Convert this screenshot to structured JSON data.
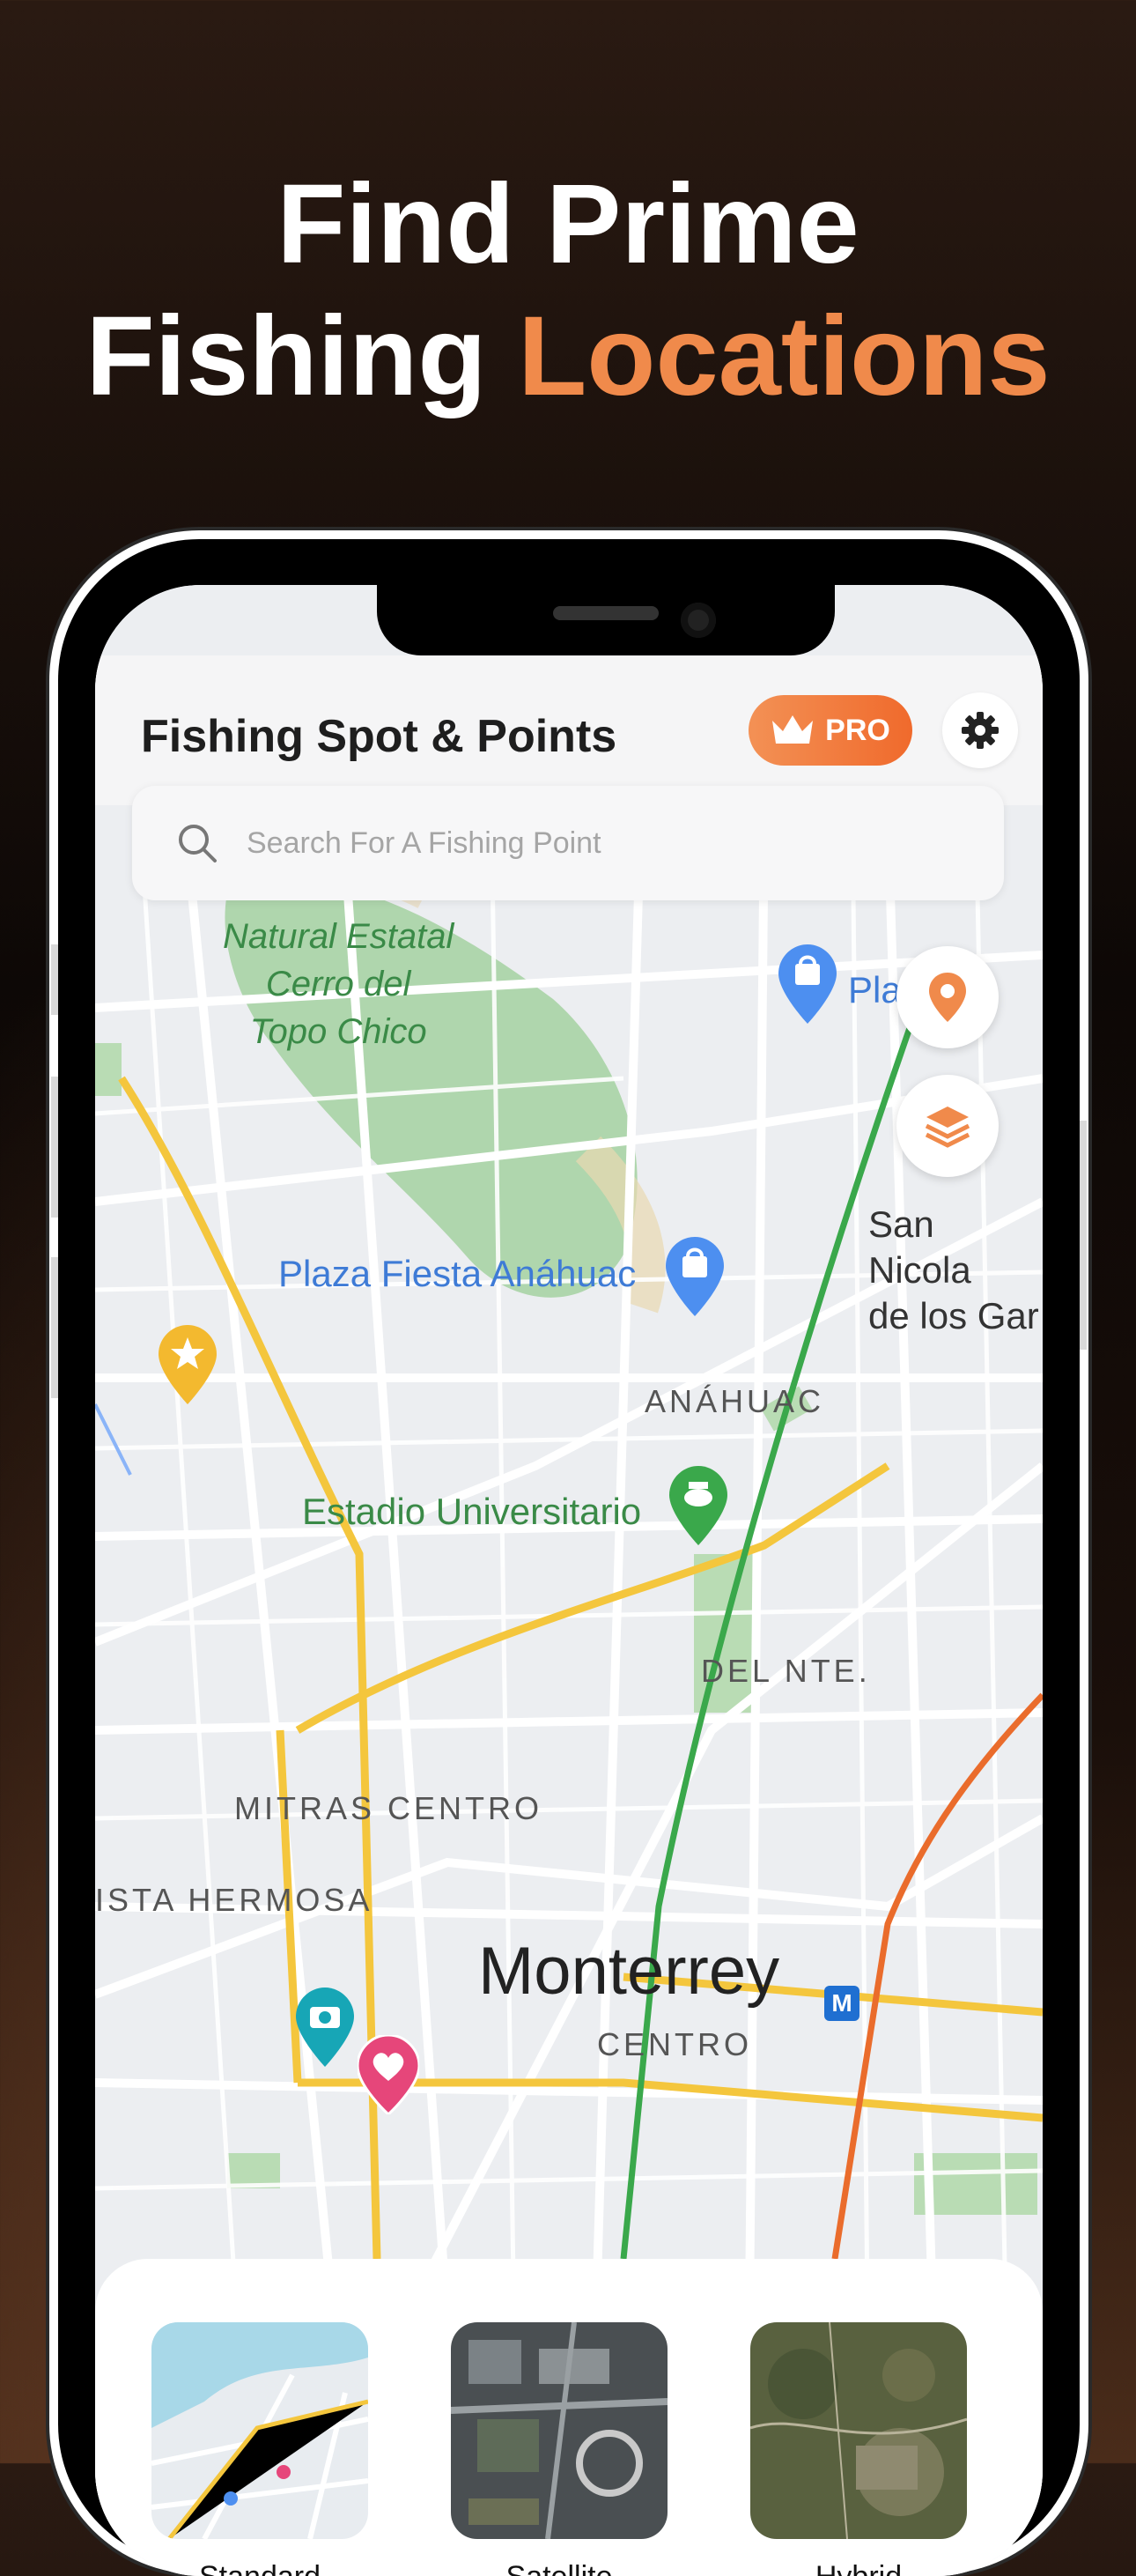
{
  "headline": {
    "line1": "Find Prime",
    "line2_plain": "Fishing ",
    "line2_accent": "Locations"
  },
  "app": {
    "title": "Fishing Spot & Points",
    "pro_label": "PRO"
  },
  "search": {
    "placeholder": "Search For A Fishing Point"
  },
  "map": {
    "labels": {
      "park": [
        "Natural Estatal",
        "Cerro del",
        "Topo Chico"
      ],
      "plaza_fiesta": "Plaza Fiesta Anáhuac",
      "plaza_partial": "Pla",
      "san_nicolas_1": "San Nicola",
      "san_nicolas_2": "de los Gar",
      "anahuac": "ANÁHUAC",
      "estadio": "Estadio Universitario",
      "del_nte": "DEL NTE.",
      "mitras": "MITRAS CENTRO",
      "vista_hermosa": "ISTA HERMOSA",
      "city": "Monterrey",
      "centro": "CENTRO",
      "metro": "M"
    }
  },
  "map_types": [
    {
      "label": "Standard"
    },
    {
      "label": "Satellite"
    },
    {
      "label": "Hybrid"
    }
  ],
  "colors": {
    "accent": "#f08a4b",
    "pro_gradient_start": "#f39155",
    "pro_gradient_end": "#f06a2c"
  }
}
